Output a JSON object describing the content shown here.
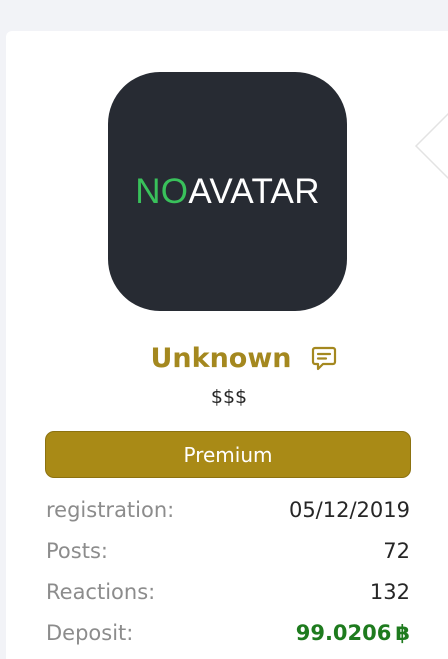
{
  "avatar": {
    "text_no": "NO",
    "text_avatar": "AVATAR"
  },
  "user": {
    "name": "Unknown",
    "title": "$$$",
    "badge": "Premium"
  },
  "stats": {
    "registration": {
      "label": "registration:",
      "value": "05/12/2019"
    },
    "posts": {
      "label": "Posts:",
      "value": "72"
    },
    "reactions": {
      "label": "Reactions:",
      "value": "132"
    },
    "deposit": {
      "label": "Deposit:",
      "value": "99.0206",
      "currency_symbol": "฿"
    }
  },
  "colors": {
    "username": "#a4881f",
    "badge_bg": "#a98a16",
    "deposit": "#1e7b1e",
    "avatar_bg": "#272b33",
    "avatar_no": "#39c15b"
  },
  "icons": {
    "message": "message-icon"
  }
}
